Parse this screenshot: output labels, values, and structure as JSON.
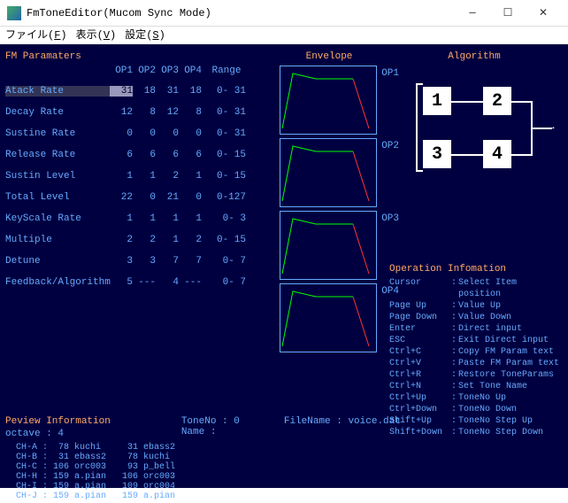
{
  "window": {
    "title": "FmToneEditor(Mucom Sync Mode)"
  },
  "menu": {
    "file": "ファイル(F)",
    "view": "表示(V)",
    "settings": "設定(S)"
  },
  "params": {
    "title": "FM Paramaters",
    "headers": [
      "OP1",
      "OP2",
      "OP3",
      "OP4"
    ],
    "range_header": "Range",
    "rows": [
      {
        "label": "Atack Rate",
        "op": [
          "31",
          "18",
          "31",
          "18"
        ],
        "range": "0- 31"
      },
      {
        "label": "Decay Rate",
        "op": [
          "12",
          "8",
          "12",
          "8"
        ],
        "range": "0- 31"
      },
      {
        "label": "Sustine Rate",
        "op": [
          "0",
          "0",
          "0",
          "0"
        ],
        "range": "0- 31"
      },
      {
        "label": "Release Rate",
        "op": [
          "6",
          "6",
          "6",
          "6"
        ],
        "range": "0- 15"
      },
      {
        "label": "Sustin Level",
        "op": [
          "1",
          "1",
          "2",
          "1"
        ],
        "range": "0- 15"
      },
      {
        "label": "Total Level",
        "op": [
          "22",
          "0",
          "21",
          "0"
        ],
        "range": "0-127"
      },
      {
        "label": "KeyScale Rate",
        "op": [
          "1",
          "1",
          "1",
          "1"
        ],
        "range": "0-  3"
      },
      {
        "label": "Multiple",
        "op": [
          "2",
          "2",
          "1",
          "2"
        ],
        "range": "0- 15"
      },
      {
        "label": "Detune",
        "op": [
          "3",
          "3",
          "7",
          "7"
        ],
        "range": "0-  7"
      },
      {
        "label": "Feedback/Algorithm",
        "op": [
          "5",
          "---",
          "4",
          "---"
        ],
        "range": "0-  7"
      }
    ]
  },
  "envelope": {
    "title": "Envelope",
    "ops": [
      "OP1",
      "OP2",
      "OP3",
      "OP4"
    ]
  },
  "algorithm": {
    "title": "Algorithm",
    "nodes": [
      "1",
      "2",
      "3",
      "4"
    ]
  },
  "opinfo": {
    "title": "Operation Infomation",
    "rows": [
      {
        "k": "Cursor",
        "v": "Select Item position"
      },
      {
        "k": "Page Up",
        "v": "Value Up"
      },
      {
        "k": "Page Down",
        "v": "Value Down"
      },
      {
        "k": "Enter",
        "v": "Direct input"
      },
      {
        "k": "ESC",
        "v": "Exit Direct input"
      },
      {
        "k": "Ctrl+C",
        "v": "Copy FM Param text"
      },
      {
        "k": "Ctrl+V",
        "v": "Paste FM Param text"
      },
      {
        "k": "Ctrl+R",
        "v": "Restore ToneParams"
      },
      {
        "k": "Ctrl+N",
        "v": "Set Tone Name"
      },
      {
        "k": "Ctrl+Up",
        "v": "ToneNo Up"
      },
      {
        "k": "Ctrl+Down",
        "v": "ToneNo Down"
      },
      {
        "k": "Shift+Up",
        "v": "ToneNo Step Up"
      },
      {
        "k": "Shift+Down",
        "v": "ToneNo Step Down"
      }
    ]
  },
  "preview": {
    "title": "Peview Information",
    "octave_label": "octave : 4",
    "toneno_label": "ToneNo : 0",
    "name_label": "Name   :",
    "filename_label": "FileName : voice.dat",
    "channels": [
      "CH-A :  78 kuchi     31 ebass2",
      "CH-B :  31 ebass2    78 kuchi",
      "CH-C : 106 orc003    93 p_bell",
      "CH-H : 159 a.pian   106 orc003",
      "CH-I : 159 a.pian   109 orc004",
      "CH-J : 159 a.pian   159 a.pian"
    ]
  }
}
